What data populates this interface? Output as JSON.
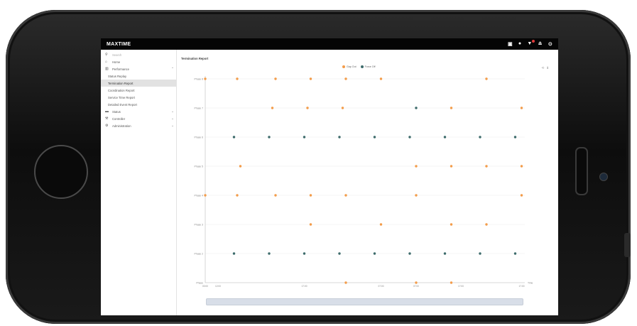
{
  "app": {
    "title": "MAXTIME"
  },
  "topbar_icons": [
    "save-icon",
    "info-icon",
    "notification-icon",
    "user-icon",
    "help-icon"
  ],
  "sidebar": {
    "search_placeholder": "Search",
    "items": [
      {
        "label": "Home",
        "icon": "home-icon"
      },
      {
        "label": "Performance",
        "icon": "bar-chart-icon",
        "chevron": "⌃"
      },
      {
        "label": "Status Replay"
      },
      {
        "label": "Termination Report",
        "active": true
      },
      {
        "label": "Coordination Report"
      },
      {
        "label": "Service Time Report"
      },
      {
        "label": "Detailed Event Report"
      },
      {
        "label": "Status",
        "icon": "car-icon",
        "chevron": "⌄"
      },
      {
        "label": "Controller",
        "icon": "wrench-icon",
        "chevron": "⌄"
      },
      {
        "label": "Administration",
        "icon": "gear-icon",
        "chevron": "⌄"
      }
    ]
  },
  "page": {
    "title": "Termination Report"
  },
  "colors": {
    "gap_out": "#f39c4a",
    "force_off": "#3d6b6b",
    "grid": "#ececec",
    "axis": "#bbbbbb"
  },
  "chart_data": {
    "type": "scatter",
    "legend": [
      "Gap Out",
      "Force Off"
    ],
    "legend_position": "top-center",
    "y_categories": [
      "Phase",
      "Phase 2",
      "Phase 3",
      "Phase 4",
      "Phase 5",
      "Phase 6",
      "Phase 7",
      "Phase 8"
    ],
    "x_axis_label": "Time",
    "x_tick_labels": [
      "00:00",
      "12:00",
      "17:00",
      "07:00",
      "07:00",
      "17:00",
      "17:00"
    ],
    "x_range": [
      0,
      100
    ],
    "series": [
      {
        "name": "Gap Out",
        "points": [
          [
            0,
            7
          ],
          [
            10,
            7
          ],
          [
            22,
            7
          ],
          [
            33,
            7
          ],
          [
            44,
            7
          ],
          [
            55,
            7
          ],
          [
            88,
            7
          ],
          [
            21,
            6
          ],
          [
            32,
            6
          ],
          [
            43,
            6
          ],
          [
            77,
            6
          ],
          [
            99,
            6
          ],
          [
            11,
            4
          ],
          [
            66,
            4
          ],
          [
            77,
            4
          ],
          [
            88,
            4
          ],
          [
            99,
            4
          ],
          [
            0,
            3
          ],
          [
            10,
            3
          ],
          [
            22,
            3
          ],
          [
            33,
            3
          ],
          [
            44,
            3
          ],
          [
            66,
            3
          ],
          [
            99,
            3
          ],
          [
            33,
            2
          ],
          [
            55,
            2
          ],
          [
            77,
            2
          ],
          [
            88,
            2
          ],
          [
            44,
            0
          ],
          [
            66,
            0
          ],
          [
            77,
            0
          ]
        ]
      },
      {
        "name": "Force Off",
        "points": [
          [
            66,
            6
          ],
          [
            9,
            5
          ],
          [
            20,
            5
          ],
          [
            31,
            5
          ],
          [
            42,
            5
          ],
          [
            53,
            5
          ],
          [
            64,
            5
          ],
          [
            75,
            5
          ],
          [
            86,
            5
          ],
          [
            97,
            5
          ],
          [
            9,
            1
          ],
          [
            20,
            1
          ],
          [
            31,
            1
          ],
          [
            42,
            1
          ],
          [
            53,
            1
          ],
          [
            64,
            1
          ],
          [
            75,
            1
          ],
          [
            86,
            1
          ],
          [
            97,
            1
          ]
        ]
      }
    ]
  }
}
